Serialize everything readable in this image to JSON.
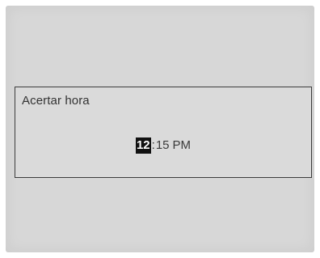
{
  "dialog": {
    "title": "Acertar hora"
  },
  "time": {
    "hour": "12",
    "separator": ":",
    "minute": "15",
    "ampm": "PM"
  }
}
